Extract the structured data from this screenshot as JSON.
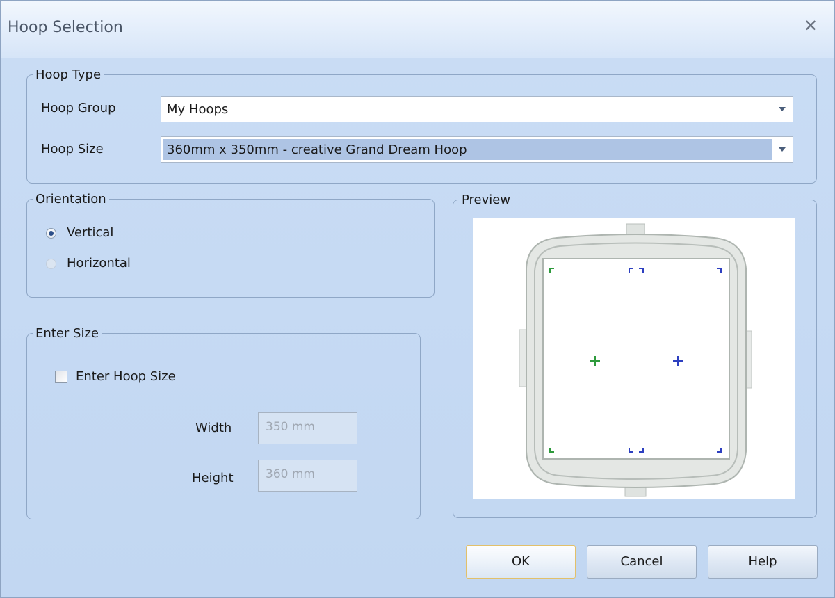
{
  "window": {
    "title": "Hoop Selection",
    "close_icon": "close-icon"
  },
  "hoop_type": {
    "legend": "Hoop Type",
    "group_label": "Hoop Group",
    "group_value": "My Hoops",
    "size_label": "Hoop Size",
    "size_value": "360mm x 350mm - creative Grand Dream Hoop"
  },
  "orientation": {
    "legend": "Orientation",
    "options": [
      {
        "label": "Vertical",
        "selected": true
      },
      {
        "label": "Horizontal",
        "selected": false
      }
    ]
  },
  "enter_size": {
    "legend": "Enter Size",
    "checkbox_label": "Enter Hoop Size",
    "checked": false,
    "width_label": "Width",
    "width_value": "350 mm",
    "height_label": "Height",
    "height_value": "360 mm"
  },
  "preview": {
    "legend": "Preview"
  },
  "buttons": {
    "ok": "OK",
    "cancel": "Cancel",
    "help": "Help"
  },
  "colors": {
    "accent": "#2c4f8a",
    "marker_green": "#2e9a3c",
    "marker_blue": "#2d3fc0"
  }
}
